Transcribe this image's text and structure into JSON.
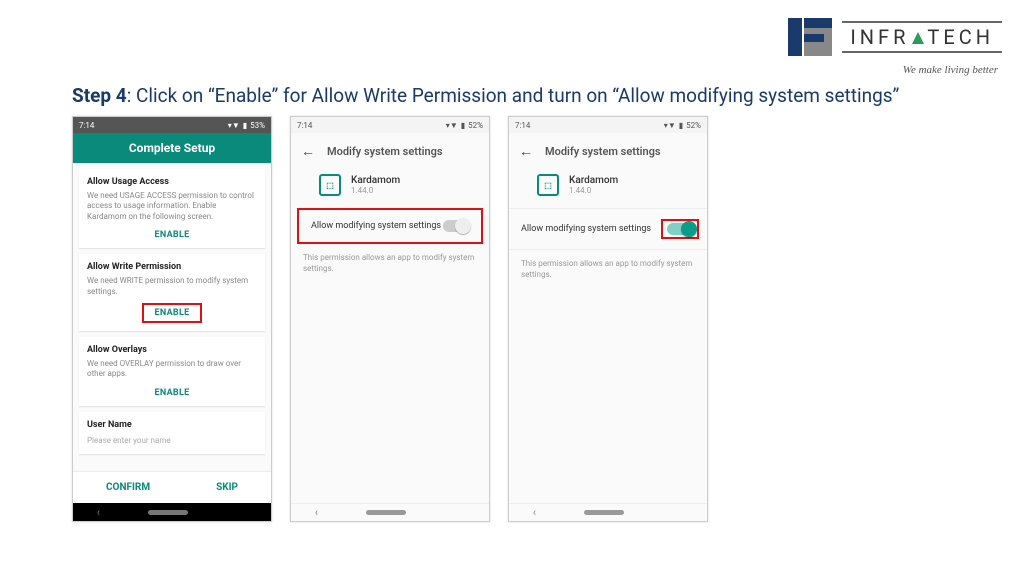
{
  "brand": {
    "name_left": "INFR",
    "name_right": "TECH",
    "tagline": "We make living better"
  },
  "heading": {
    "step_label": "Step 4",
    "text": ": Click on “Enable” for Allow Write Permission and turn on “Allow modifying system settings”"
  },
  "phone1": {
    "time": "7:14",
    "battery": "53%",
    "header": "Complete Setup",
    "cards": [
      {
        "title": "Allow Usage Access",
        "text": "We need USAGE ACCESS permission to control access to usage information. Enable Kardamom on the following screen.",
        "btn": "ENABLE",
        "highlight": false
      },
      {
        "title": "Allow Write Permission",
        "text": "We need WRITE permission to modify system settings.",
        "btn": "ENABLE",
        "highlight": true
      },
      {
        "title": "Allow Overlays",
        "text": "We need OVERLAY permission to draw over other apps.",
        "btn": "ENABLE",
        "highlight": false
      }
    ],
    "user_card": {
      "title": "User Name",
      "placeholder": "Please enter your name"
    },
    "bottom": {
      "confirm": "CONFIRM",
      "skip": "SKIP"
    }
  },
  "phone2": {
    "time": "7:14",
    "battery": "52%",
    "header": "Modify system settings",
    "app": {
      "name": "Kardamom",
      "version": "1.44.0"
    },
    "toggle_label": "Allow modifying system settings",
    "toggle_on": false,
    "desc": "This permission allows an app to modify system settings."
  },
  "phone3": {
    "time": "7:14",
    "battery": "52%",
    "header": "Modify system settings",
    "app": {
      "name": "Kardamom",
      "version": "1.44.0"
    },
    "toggle_label": "Allow modifying system settings",
    "toggle_on": true,
    "desc": "This permission allows an app to modify system settings."
  }
}
